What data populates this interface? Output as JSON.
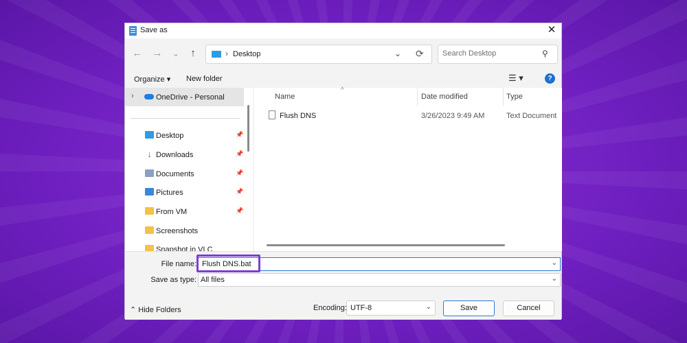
{
  "window": {
    "title": "Save as",
    "close_glyph": "✕"
  },
  "nav": {
    "back_glyph": "←",
    "forward_glyph": "→",
    "recent_glyph": "⌄",
    "up_glyph": "↑",
    "address": "Desktop",
    "address_sep": "›",
    "address_dropdown": "⌄",
    "refresh_glyph": "⟳",
    "search_placeholder": "Search Desktop",
    "search_glyph": "⚲"
  },
  "toolbar": {
    "organize_label": "Organize ▾",
    "new_folder_label": "New folder",
    "view_glyph": "☰ ▾",
    "help_glyph": "?"
  },
  "sidebar": {
    "onedrive": {
      "label": "OneDrive - Personal",
      "chevron": "›"
    },
    "items": [
      {
        "label": "Desktop",
        "icon": "desktop-icon",
        "pinned": true
      },
      {
        "label": "Downloads",
        "icon": "download-icon",
        "pinned": true
      },
      {
        "label": "Documents",
        "icon": "documents-icon",
        "pinned": true
      },
      {
        "label": "Pictures",
        "icon": "pictures-icon",
        "pinned": true
      },
      {
        "label": "From VM",
        "icon": "folder-icon",
        "pinned": true
      },
      {
        "label": "Screenshots",
        "icon": "folder-icon",
        "pinned": false
      },
      {
        "label": "Snapshot in VLC",
        "icon": "folder-icon",
        "pinned": false
      }
    ],
    "pin_glyph": "📌"
  },
  "files": {
    "columns": [
      "Name",
      "Date modified",
      "Type"
    ],
    "sort_glyph": "^",
    "rows": [
      {
        "name": "Flush DNS",
        "date": "3/26/2023 9:49 AM",
        "type": "Text Document"
      }
    ]
  },
  "form": {
    "file_name_label": "File name:",
    "file_name_value": "Flush DNS.bat",
    "save_type_label": "Save as type:",
    "save_type_value": "All files",
    "dropdown_glyph": "⌄"
  },
  "footer": {
    "hide_folders_label": "⌃  Hide Folders",
    "encoding_label": "Encoding:",
    "encoding_value": "UTF-8",
    "save_label": "Save",
    "cancel_label": "Cancel"
  },
  "colors": {
    "background": "#6f1fc0",
    "highlight": "#7b3fd0",
    "accent": "#2a7ad8"
  }
}
